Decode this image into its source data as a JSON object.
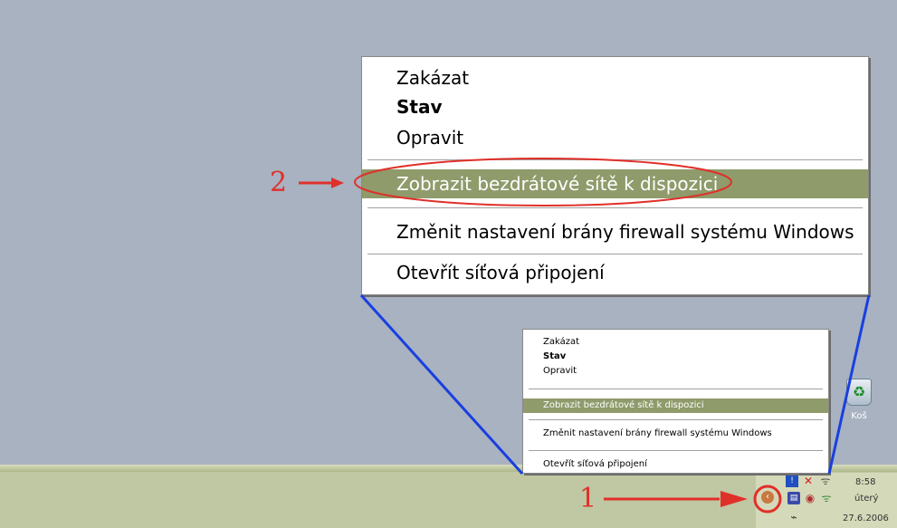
{
  "menu": {
    "items": [
      {
        "label": "Zakázat",
        "style": "normal"
      },
      {
        "label": "Stav",
        "style": "bold"
      },
      {
        "label": "Opravit",
        "style": "normal"
      },
      {
        "label": "Zobrazit bezdrátové sítě k dispozici",
        "style": "highlighted"
      },
      {
        "label": "Změnit nastavení brány firewall systému Windows",
        "style": "normal"
      },
      {
        "label": "Otevřít síťová připojení",
        "style": "normal"
      }
    ]
  },
  "callouts": {
    "one": "1",
    "two": "2"
  },
  "desktop": {
    "recycle_bin_label": "Koš"
  },
  "tray": {
    "time": "8:58",
    "day": "úterý",
    "date": "27.6.2006",
    "icons": [
      "security-alert-icon",
      "network-x-icon",
      "wireless-icon",
      "network-icon"
    ]
  },
  "colors": {
    "desktop": "#a8b2c1",
    "highlight": "#8f9b6b",
    "annotation_red": "#e0302a",
    "annotation_blue": "#1a3fe0"
  }
}
